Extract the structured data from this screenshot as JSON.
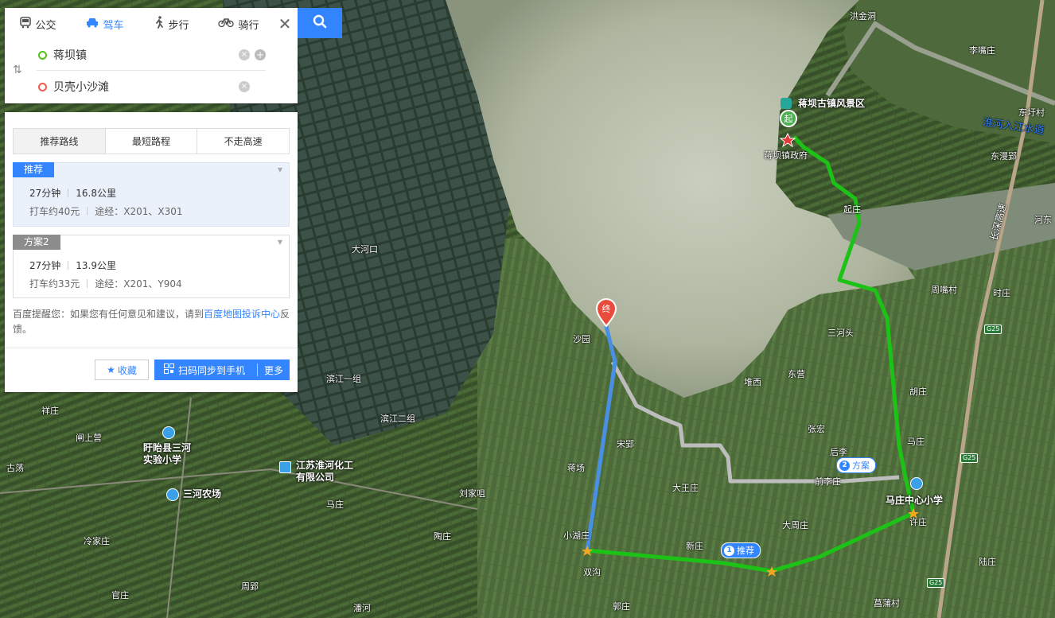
{
  "transport_modes": [
    {
      "label": "公交",
      "icon": "bus-icon"
    },
    {
      "label": "驾车",
      "icon": "car-icon",
      "active": true
    },
    {
      "label": "步行",
      "icon": "walk-icon"
    },
    {
      "label": "骑行",
      "icon": "bike-icon"
    }
  ],
  "origin": "蒋坝镇",
  "destination": "贝壳小沙滩",
  "route_tabs": [
    "推荐路线",
    "最短路程",
    "不走高速"
  ],
  "routes": [
    {
      "tag": "推荐",
      "duration": "27分钟",
      "distance": "16.8公里",
      "taxi": "打车约40元",
      "via": "途经：X201、X301"
    },
    {
      "tag": "方案2",
      "duration": "27分钟",
      "distance": "13.9公里",
      "taxi": "打车约33元",
      "via": "途经：X201、Y904"
    }
  ],
  "notice": {
    "prefix": "百度提醒您：如果您有任何意见和建议，请到",
    "link": "百度地图投诉中心",
    "suffix": "反馈。"
  },
  "buttons": {
    "favorite": "收藏",
    "sync": "扫码同步到手机",
    "more": "更多"
  },
  "map": {
    "start_marker": "起",
    "end_marker": "终",
    "route_badges": [
      {
        "num": "1",
        "label": "推荐"
      },
      {
        "num": "2",
        "label": "方案"
      }
    ],
    "pois": {
      "scenic": "蒋坝古镇风景区",
      "govt": "蒋坝镇政府",
      "school1": "盱眙县三河\n实验小学",
      "chemical": "江苏淮河化工\n有限公司",
      "farm": "三河农场",
      "school2": "马庄中心小学"
    },
    "place_labels": [
      "洪金洞",
      "李嘴庄",
      "东圩村",
      "东漫郢",
      "河东",
      "大河口",
      "起庄",
      "周嘴村",
      "时庄",
      "三河头",
      "沙园",
      "东营",
      "堆西",
      "胡庄",
      "滨江一组",
      "滨江二组",
      "祥庄",
      "宋郢",
      "张宏",
      "马庄",
      "后李",
      "前李庄",
      "蒋场",
      "闸上营",
      "古荡",
      "大王庄",
      "刘家咀",
      "马庄",
      "冷家庄",
      "陶庄",
      "周郢",
      "双沟",
      "小湖庄",
      "许庄",
      "大周庄",
      "陆庄",
      "官庄",
      "新庄",
      "郭庄",
      "潘河",
      "菖蒲村",
      "淮河入江水道"
    ],
    "highway_shields": [
      "G25",
      "G25",
      "G25"
    ],
    "highway_name": "长深高速",
    "colors": {
      "primary_route": "#1dc216",
      "alt_route": "#bdbdbd",
      "selected_segment": "#4a90e2",
      "accent": "#3385ff"
    }
  }
}
